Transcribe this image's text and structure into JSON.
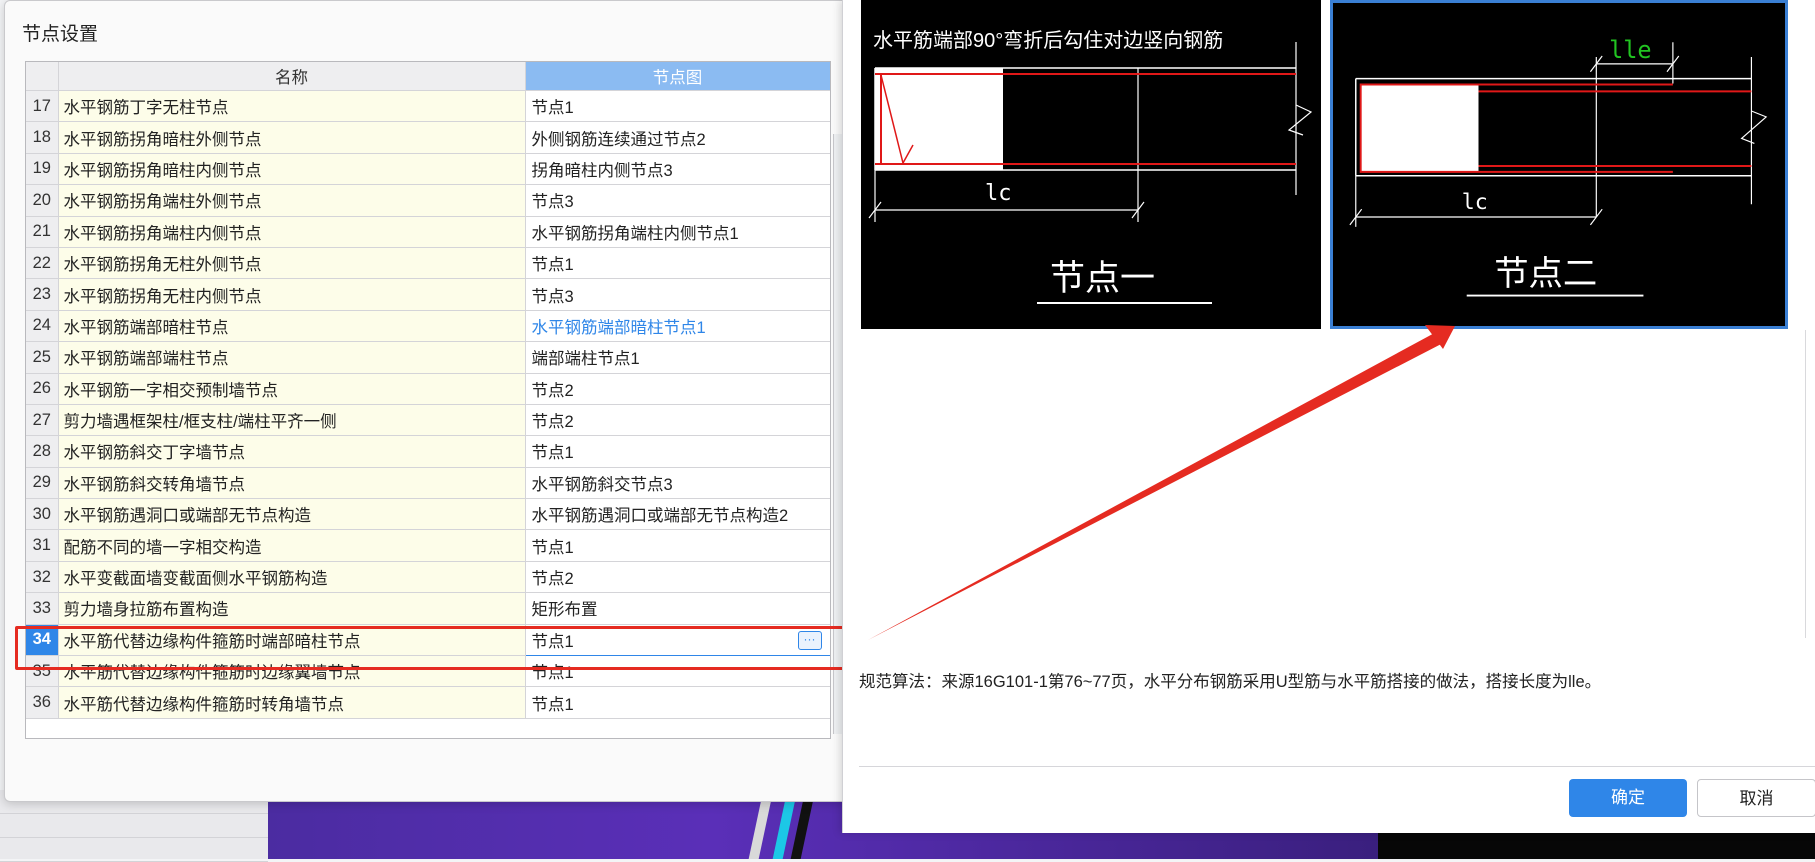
{
  "dialog": {
    "title": "节点设置",
    "columns": {
      "name": "名称",
      "node": "节点图"
    },
    "rows": [
      {
        "idx": "17",
        "name": "水平钢筋丁字无柱节点",
        "node": "节点1"
      },
      {
        "idx": "18",
        "name": "水平钢筋拐角暗柱外侧节点",
        "node": "外侧钢筋连续通过节点2"
      },
      {
        "idx": "19",
        "name": "水平钢筋拐角暗柱内侧节点",
        "node": "拐角暗柱内侧节点3"
      },
      {
        "idx": "20",
        "name": "水平钢筋拐角端柱外侧节点",
        "node": "节点3"
      },
      {
        "idx": "21",
        "name": "水平钢筋拐角端柱内侧节点",
        "node": "水平钢筋拐角端柱内侧节点1"
      },
      {
        "idx": "22",
        "name": "水平钢筋拐角无柱外侧节点",
        "node": "节点1"
      },
      {
        "idx": "23",
        "name": "水平钢筋拐角无柱内侧节点",
        "node": "节点3"
      },
      {
        "idx": "24",
        "name": "水平钢筋端部暗柱节点",
        "node": "水平钢筋端部暗柱节点1"
      },
      {
        "idx": "25",
        "name": "水平钢筋端部端柱节点",
        "node": "端部端柱节点1"
      },
      {
        "idx": "26",
        "name": "水平钢筋一字相交预制墙节点",
        "node": "节点2"
      },
      {
        "idx": "27",
        "name": "剪力墙遇框架柱/框支柱/端柱平齐一侧",
        "node": "节点2"
      },
      {
        "idx": "28",
        "name": "水平钢筋斜交丁字墙节点",
        "node": "节点1"
      },
      {
        "idx": "29",
        "name": "水平钢筋斜交转角墙节点",
        "node": "水平钢筋斜交节点3"
      },
      {
        "idx": "30",
        "name": "水平钢筋遇洞口或端部无节点构造",
        "node": "水平钢筋遇洞口或端部无节点构造2"
      },
      {
        "idx": "31",
        "name": "配筋不同的墙一字相交构造",
        "node": "节点1"
      },
      {
        "idx": "32",
        "name": "水平变截面墙变截面侧水平钢筋构造",
        "node": "节点2"
      },
      {
        "idx": "33",
        "name": "剪力墙身拉筋布置构造",
        "node": "矩形布置"
      },
      {
        "idx": "34",
        "name": "水平筋代替边缘构件箍筋时端部暗柱节点",
        "node": "节点1"
      },
      {
        "idx": "35",
        "name": "水平筋代替边缘构件箍筋时边缘翼墙节点",
        "node": "节点1"
      },
      {
        "idx": "36",
        "name": "水平筋代替边缘构件箍筋时转角墙节点",
        "node": "节点1"
      }
    ],
    "selected_row": "34",
    "linked_row": "24",
    "ellipsis": "···"
  },
  "preview": {
    "node1": {
      "caption": "水平筋端部90°弯折后勾住对边竖向钢筋",
      "dim": "lc",
      "label": "节点一"
    },
    "node2": {
      "dim_top": "lle",
      "dim": "lc",
      "label": "节点二"
    }
  },
  "rule_text": "规范算法：来源16G101-1第76~77页，水平分布钢筋采用U型筋与水平筋搭接的做法，搭接长度为lle。",
  "buttons": {
    "ok": "确定",
    "cancel": "取消"
  },
  "colors": {
    "accent": "#2f86e8",
    "highlight": "#e52b21",
    "rebar": "#e01818",
    "dim_green": "#21c421"
  },
  "icons": {
    "arrow": "red-arrow-icon"
  }
}
